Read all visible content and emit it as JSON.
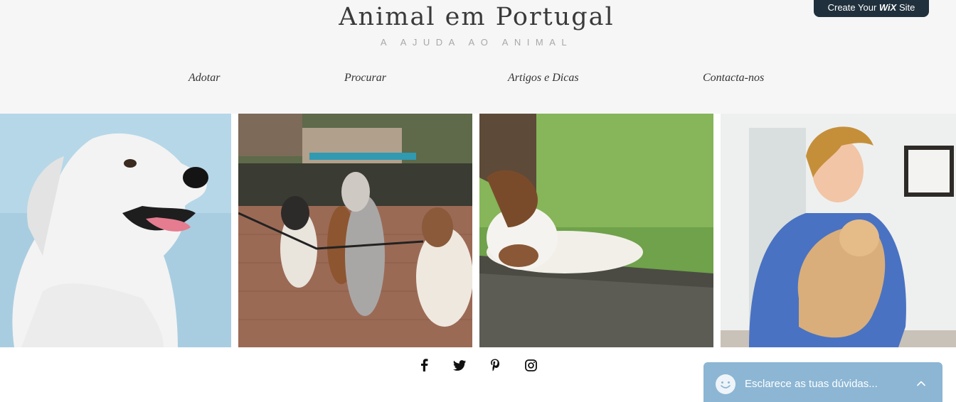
{
  "header": {
    "title": "Animal em Portugal",
    "tagline": "A AJUDA AO ANIMAL"
  },
  "nav": {
    "items": [
      "Adotar",
      "Procurar",
      "Artigos e Dicas",
      "Contacta-nos"
    ]
  },
  "wix_banner": {
    "prefix": "Create Your",
    "brand": "WiX",
    "suffix": "Site"
  },
  "gallery": {
    "images": [
      "white-dog-photo",
      "dogs-on-leash-photo",
      "sleeping-dog-photo",
      "vet-with-dog-photo"
    ]
  },
  "social": {
    "icons": [
      "facebook-icon",
      "twitter-icon",
      "pinterest-icon",
      "instagram-icon"
    ]
  },
  "chat": {
    "label": "Esclarece as tuas dúvidas..."
  },
  "colors": {
    "header_bg": "#f6f6f6",
    "wix_banner_bg": "#20303c",
    "chat_bg": "#8cb6d4"
  }
}
